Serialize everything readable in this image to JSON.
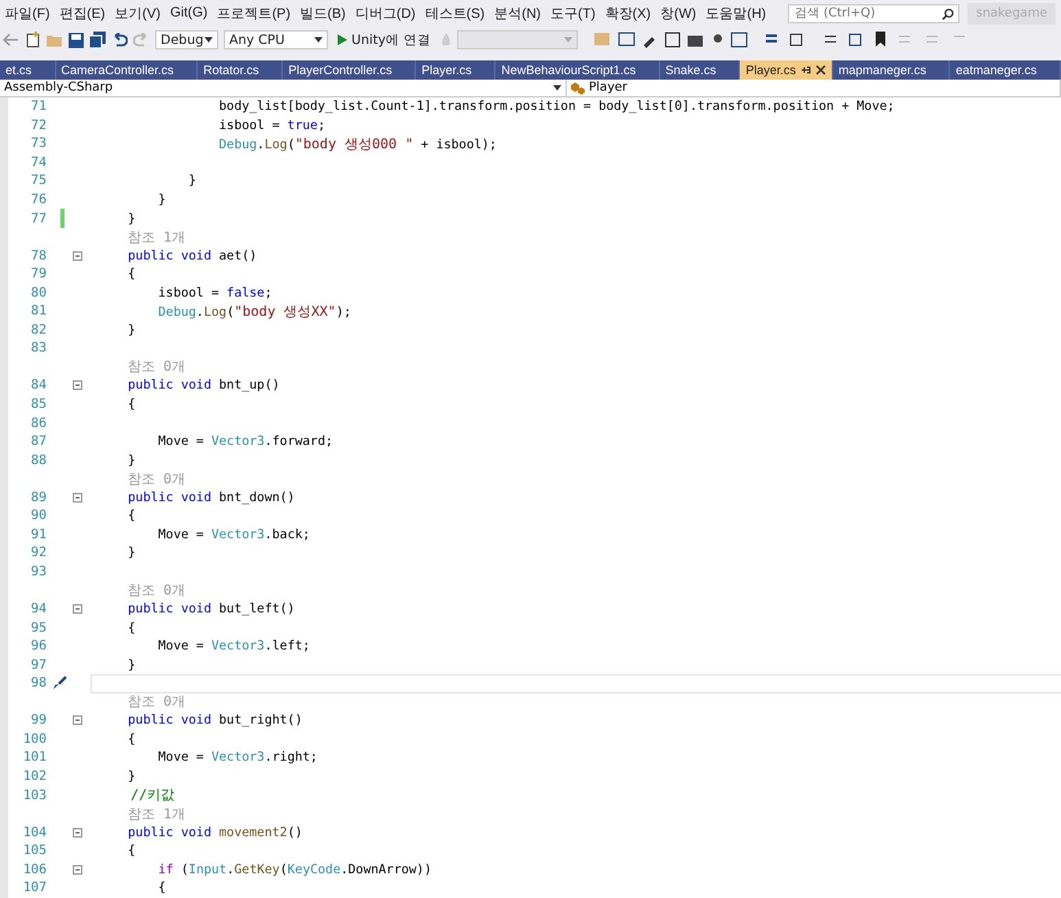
{
  "menu_bar": {
    "items": [
      "파일(F)",
      "편집(E)",
      "보기(V)",
      "Git(G)",
      "프로젝트(P)",
      "빌드(B)",
      "디버그(D)",
      "테스트(S)",
      "분석(N)",
      "도구(T)",
      "확장(X)",
      "창(W)",
      "도움말(H)"
    ],
    "search": {
      "placeholder": "검색 (Ctrl+Q)"
    },
    "solution_name": "snakegame"
  },
  "toolbar": {
    "configuration": "Debug",
    "platform": "Any CPU",
    "run_button": "Unity에 연결"
  },
  "tabs": [
    {
      "label": "et.cs",
      "selected": false
    },
    {
      "label": "CameraController.cs",
      "selected": false
    },
    {
      "label": "Rotator.cs",
      "selected": false
    },
    {
      "label": "PlayerController.cs",
      "selected": false
    },
    {
      "label": "Player.cs",
      "selected": false
    },
    {
      "label": "NewBehaviourScript1.cs",
      "selected": false
    },
    {
      "label": "Snake.cs",
      "selected": false
    },
    {
      "label": "Player.cs",
      "selected": true
    },
    {
      "label": "mapmaneger.cs",
      "selected": false
    },
    {
      "label": "eatmaneger.cs",
      "selected": false
    }
  ],
  "navigation_bar": {
    "project": "Assembly-CSharp",
    "type": "Player"
  },
  "editor": {
    "rows": [
      {
        "kind": "code",
        "number": "71",
        "fold": false,
        "changed": false,
        "current": false,
        "tokens": [
          {
            "text": "                body_list[body_list.Count-1].transform.position = body_list[0].transform.position + Move;",
            "kind": "plain"
          }
        ]
      },
      {
        "kind": "code",
        "number": "72",
        "fold": false,
        "changed": false,
        "current": false,
        "tokens": [
          {
            "text": "                isbool = ",
            "kind": "plain"
          },
          {
            "text": "true",
            "kind": "keyword"
          },
          {
            "text": ";",
            "kind": "plain"
          }
        ]
      },
      {
        "kind": "code",
        "number": "73",
        "fold": false,
        "changed": false,
        "current": false,
        "tokens": [
          {
            "text": "                Debug",
            "kind": "type"
          },
          {
            "text": ".",
            "kind": "plain"
          },
          {
            "text": "Log",
            "kind": "method"
          },
          {
            "text": "(",
            "kind": "plain"
          },
          {
            "text": "\"body 생성000 \"",
            "kind": "string"
          },
          {
            "text": " + isbool);",
            "kind": "plain"
          }
        ]
      },
      {
        "kind": "code",
        "number": "74",
        "fold": false,
        "changed": false,
        "current": false
      },
      {
        "kind": "code",
        "number": "75",
        "fold": false,
        "changed": false,
        "current": false,
        "tokens": [
          {
            "text": "            }",
            "kind": "plain"
          }
        ]
      },
      {
        "kind": "code",
        "number": "76",
        "fold": false,
        "changed": false,
        "current": false,
        "tokens": [
          {
            "text": "        }",
            "kind": "plain"
          }
        ]
      },
      {
        "kind": "code",
        "number": "77",
        "fold": false,
        "changed": true,
        "current": false,
        "tokens": [
          {
            "text": "    }",
            "kind": "plain"
          }
        ]
      },
      {
        "kind": "lens",
        "text": "참조 1개"
      },
      {
        "kind": "code",
        "number": "78",
        "fold": true,
        "changed": false,
        "current": false,
        "tokens": [
          {
            "text": "    public void",
            "kind": "keyword"
          },
          {
            "text": " aet()",
            "kind": "plain"
          }
        ]
      },
      {
        "kind": "code",
        "number": "79",
        "fold": false,
        "changed": false,
        "current": false,
        "tokens": [
          {
            "text": "    {",
            "kind": "plain"
          }
        ]
      },
      {
        "kind": "code",
        "number": "80",
        "fold": false,
        "changed": false,
        "current": false,
        "tokens": [
          {
            "text": "        isbool = ",
            "kind": "plain"
          },
          {
            "text": "false",
            "kind": "keyword"
          },
          {
            "text": ";",
            "kind": "plain"
          }
        ]
      },
      {
        "kind": "code",
        "number": "81",
        "fold": false,
        "changed": false,
        "current": false,
        "tokens": [
          {
            "text": "        Debug",
            "kind": "type"
          },
          {
            "text": ".",
            "kind": "plain"
          },
          {
            "text": "Log",
            "kind": "method"
          },
          {
            "text": "(",
            "kind": "plain"
          },
          {
            "text": "\"body 생성XX\"",
            "kind": "string"
          },
          {
            "text": ");",
            "kind": "plain"
          }
        ]
      },
      {
        "kind": "code",
        "number": "82",
        "fold": false,
        "changed": false,
        "current": false,
        "tokens": [
          {
            "text": "    }",
            "kind": "plain"
          }
        ]
      },
      {
        "kind": "code",
        "number": "83",
        "fold": false,
        "changed": false,
        "current": false
      },
      {
        "kind": "lens",
        "text": "참조 0개"
      },
      {
        "kind": "code",
        "number": "84",
        "fold": true,
        "changed": false,
        "current": false,
        "tokens": [
          {
            "text": "    public void",
            "kind": "keyword"
          },
          {
            "text": " bnt_up()",
            "kind": "plain"
          }
        ]
      },
      {
        "kind": "code",
        "number": "85",
        "fold": false,
        "changed": false,
        "current": false,
        "tokens": [
          {
            "text": "    {",
            "kind": "plain"
          }
        ]
      },
      {
        "kind": "code",
        "number": "86",
        "fold": false,
        "changed": false,
        "current": false
      },
      {
        "kind": "code",
        "number": "87",
        "fold": false,
        "changed": false,
        "current": false,
        "tokens": [
          {
            "text": "        Move = ",
            "kind": "plain"
          },
          {
            "text": "Vector3",
            "kind": "type"
          },
          {
            "text": ".forward;",
            "kind": "plain"
          }
        ]
      },
      {
        "kind": "code",
        "number": "88",
        "fold": false,
        "changed": false,
        "current": false,
        "tokens": [
          {
            "text": "    }",
            "kind": "plain"
          }
        ]
      },
      {
        "kind": "lens",
        "text": "참조 0개"
      },
      {
        "kind": "code",
        "number": "89",
        "fold": true,
        "changed": false,
        "current": false,
        "tokens": [
          {
            "text": "    public void",
            "kind": "keyword"
          },
          {
            "text": " bnt_down()",
            "kind": "plain"
          }
        ]
      },
      {
        "kind": "code",
        "number": "90",
        "fold": false,
        "changed": false,
        "current": false,
        "tokens": [
          {
            "text": "    {",
            "kind": "plain"
          }
        ]
      },
      {
        "kind": "code",
        "number": "91",
        "fold": false,
        "changed": false,
        "current": false,
        "tokens": [
          {
            "text": "        Move = ",
            "kind": "plain"
          },
          {
            "text": "Vector3",
            "kind": "type"
          },
          {
            "text": ".back;",
            "kind": "plain"
          }
        ]
      },
      {
        "kind": "code",
        "number": "92",
        "fold": false,
        "changed": false,
        "current": false,
        "tokens": [
          {
            "text": "    }",
            "kind": "plain"
          }
        ]
      },
      {
        "kind": "code",
        "number": "93",
        "fold": false,
        "changed": false,
        "current": false
      },
      {
        "kind": "lens",
        "text": "참조 0개"
      },
      {
        "kind": "code",
        "number": "94",
        "fold": true,
        "changed": false,
        "current": false,
        "tokens": [
          {
            "text": "    public void",
            "kind": "keyword"
          },
          {
            "text": " but_left()",
            "kind": "plain"
          }
        ]
      },
      {
        "kind": "code",
        "number": "95",
        "fold": false,
        "changed": false,
        "current": false,
        "tokens": [
          {
            "text": "    {",
            "kind": "plain"
          }
        ]
      },
      {
        "kind": "code",
        "number": "96",
        "fold": false,
        "changed": false,
        "current": false,
        "tokens": [
          {
            "text": "        Move = ",
            "kind": "plain"
          },
          {
            "text": "Vector3",
            "kind": "type"
          },
          {
            "text": ".left;",
            "kind": "plain"
          }
        ]
      },
      {
        "kind": "code",
        "number": "97",
        "fold": false,
        "changed": false,
        "current": false,
        "tokens": [
          {
            "text": "    }",
            "kind": "plain"
          }
        ]
      },
      {
        "kind": "code",
        "number": "98",
        "fold": false,
        "changed": false,
        "current": true
      },
      {
        "kind": "lens",
        "text": "참조 0개"
      },
      {
        "kind": "code",
        "number": "99",
        "fold": true,
        "changed": false,
        "current": false,
        "tokens": [
          {
            "text": "    public void",
            "kind": "keyword"
          },
          {
            "text": " but_right()",
            "kind": "plain"
          }
        ]
      },
      {
        "kind": "code",
        "number": "100",
        "fold": false,
        "changed": false,
        "current": false,
        "tokens": [
          {
            "text": "    {",
            "kind": "plain"
          }
        ]
      },
      {
        "kind": "code",
        "number": "101",
        "fold": false,
        "changed": false,
        "current": false,
        "tokens": [
          {
            "text": "        Move = ",
            "kind": "plain"
          },
          {
            "text": "Vector3",
            "kind": "type"
          },
          {
            "text": ".right;",
            "kind": "plain"
          }
        ]
      },
      {
        "kind": "code",
        "number": "102",
        "fold": false,
        "changed": false,
        "current": false,
        "tokens": [
          {
            "text": "    }",
            "kind": "plain"
          }
        ]
      },
      {
        "kind": "code",
        "number": "103",
        "fold": false,
        "changed": false,
        "current": false,
        "tokens": [
          {
            "text": "    //키값",
            "kind": "comment"
          }
        ]
      },
      {
        "kind": "lens",
        "text": "참조 1개"
      },
      {
        "kind": "code",
        "number": "104",
        "fold": true,
        "changed": false,
        "current": false,
        "tokens": [
          {
            "text": "    public void",
            "kind": "keyword"
          },
          {
            "text": " movement2",
            "kind": "method"
          },
          {
            "text": "()",
            "kind": "plain"
          }
        ]
      },
      {
        "kind": "code",
        "number": "105",
        "fold": false,
        "changed": false,
        "current": false,
        "tokens": [
          {
            "text": "    {",
            "kind": "plain"
          }
        ]
      },
      {
        "kind": "code",
        "number": "106",
        "fold": true,
        "changed": false,
        "current": false,
        "tokens": [
          {
            "text": "        if",
            "kind": "control"
          },
          {
            "text": " (",
            "kind": "plain"
          },
          {
            "text": "Input",
            "kind": "type"
          },
          {
            "text": ".",
            "kind": "plain"
          },
          {
            "text": "GetKey",
            "kind": "method"
          },
          {
            "text": "(",
            "kind": "plain"
          },
          {
            "text": "KeyCode",
            "kind": "type"
          },
          {
            "text": ".DownArrow))",
            "kind": "plain"
          }
        ]
      },
      {
        "kind": "code",
        "number": "107",
        "fold": false,
        "changed": false,
        "current": false,
        "tokens": [
          {
            "text": "        {",
            "kind": "plain"
          }
        ]
      }
    ]
  }
}
